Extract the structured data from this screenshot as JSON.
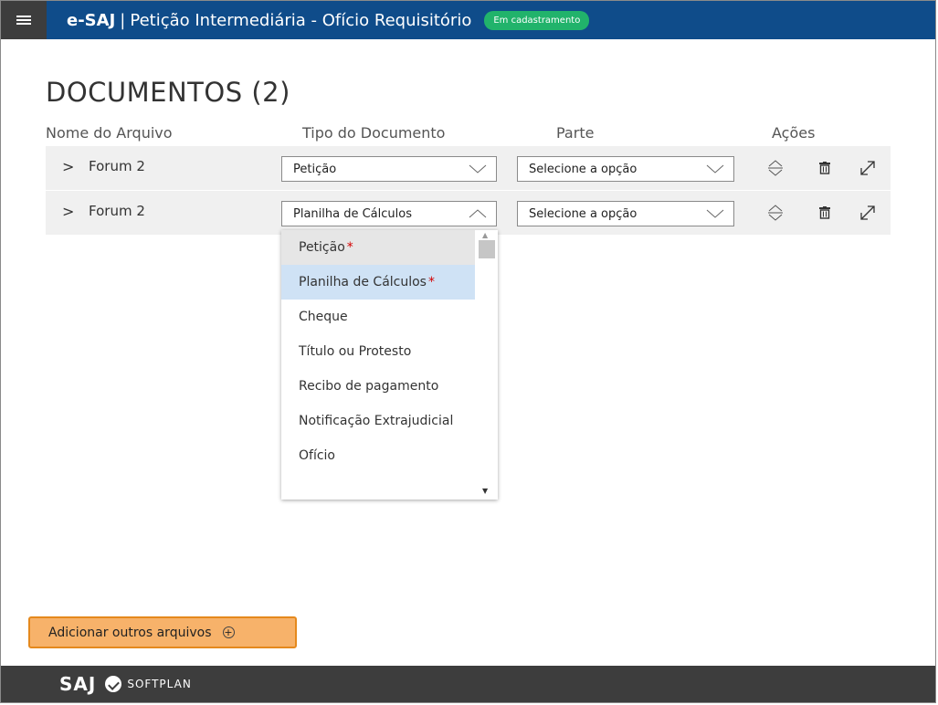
{
  "header": {
    "brand": "e-SAJ",
    "separator": "|",
    "title": "Petição Intermediária - Ofício Requisitório",
    "status_badge": "Em cadastramento"
  },
  "documents": {
    "heading": "DOCUMENTOS (2)",
    "columns": {
      "file_name": "Nome do Arquivo",
      "doc_type": "Tipo do Documento",
      "party": "Parte",
      "actions": "Ações"
    },
    "rows": [
      {
        "file_name": "Forum 2",
        "doc_type": "Petição",
        "party": "Selecione a opção"
      },
      {
        "file_name": "Forum 2",
        "doc_type": "Planilha de Cálculos",
        "party": "Selecione a opção"
      }
    ],
    "expand_glyph": ">"
  },
  "dropdown": {
    "options": [
      {
        "label": "Petição",
        "required": "*"
      },
      {
        "label": "Planilha de Cálculos",
        "required": "*"
      },
      {
        "label": "Cheque"
      },
      {
        "label": "Título ou Protesto"
      },
      {
        "label": "Recibo de pagamento"
      },
      {
        "label": "Notificação Extrajudicial"
      },
      {
        "label": "Ofício"
      }
    ],
    "selected": "Planilha de Cálculos"
  },
  "add_files_button": "Adicionar outros arquivos",
  "footer": {
    "saj": "SAJ",
    "softplan": "SOFTPLAN"
  },
  "colors": {
    "header_bg": "#0f4c8a",
    "badge_green": "#21b36b",
    "add_button_bg": "#f7b26a",
    "add_button_border": "#e5891d",
    "footer_bg": "#3d3d3d",
    "selected_option_bg": "#cfe2f5"
  },
  "icons": [
    "hamburger-icon",
    "chevron-right-icon",
    "chevron-down-icon",
    "chevron-up-icon",
    "reorder-icon",
    "trash-icon",
    "expand-icon",
    "plus-circle-icon",
    "softplan-logo-icon"
  ]
}
